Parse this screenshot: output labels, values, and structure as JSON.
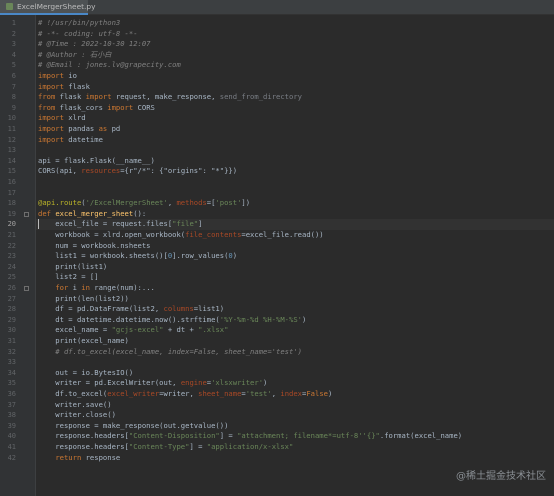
{
  "tab": {
    "file_name": "ExcelMergerSheet.py",
    "icon": "python-file-icon"
  },
  "current_line": 20,
  "lines": [
    [
      [
        "cm",
        "# !/usr/bin/python3"
      ]
    ],
    [
      [
        "cm",
        "# -*- coding: utf-8 -*-"
      ]
    ],
    [
      [
        "cm",
        "# @Time : 2022-10-30 12:07"
      ]
    ],
    [
      [
        "cm",
        "# @Author : 石小白"
      ]
    ],
    [
      [
        "cm",
        "# @Email : jones.lv@grapecity.com"
      ]
    ],
    [
      [
        "kw",
        "import"
      ],
      [
        "tx",
        " io"
      ]
    ],
    [
      [
        "kw",
        "import"
      ],
      [
        "tx",
        " flask"
      ]
    ],
    [
      [
        "kw",
        "from"
      ],
      [
        "tx",
        " flask "
      ],
      [
        "kw",
        "import"
      ],
      [
        "tx",
        " request, make_response, "
      ],
      [
        "dim",
        "send_from_directory"
      ]
    ],
    [
      [
        "kw",
        "from"
      ],
      [
        "tx",
        " flask_cors "
      ],
      [
        "kw",
        "import"
      ],
      [
        "tx",
        " CORS"
      ]
    ],
    [
      [
        "kw",
        "import"
      ],
      [
        "tx",
        " xlrd"
      ]
    ],
    [
      [
        "kw",
        "import"
      ],
      [
        "tx",
        " pandas "
      ],
      [
        "kw",
        "as"
      ],
      [
        "tx",
        " pd"
      ]
    ],
    [
      [
        "kw",
        "import"
      ],
      [
        "tx",
        " datetime"
      ]
    ],
    [],
    [
      [
        "tx",
        "api = flask.Flask(__name__)"
      ]
    ],
    [
      [
        "tx",
        "CORS(api, "
      ],
      [
        "pm",
        "resources"
      ],
      [
        "tx",
        "={r\"/*\": {\"origins\": \"*\"}})"
      ]
    ],
    [],
    [],
    [
      [
        "dc",
        "@api.route"
      ],
      [
        "tx",
        "("
      ],
      [
        "st",
        "'/ExcelMergerSheet'"
      ],
      [
        "tx",
        ", "
      ],
      [
        "pm",
        "methods"
      ],
      [
        "tx",
        "=["
      ],
      [
        "st",
        "'post'"
      ],
      [
        "tx",
        "])"
      ]
    ],
    [
      [
        "kw",
        "def "
      ],
      [
        "fn",
        "excel_merger_sheet"
      ],
      [
        "tx",
        "():"
      ]
    ],
    [
      [
        "tx",
        "    excel_file = request.files["
      ],
      [
        "st",
        "\"file\""
      ],
      [
        "tx",
        "]"
      ]
    ],
    [
      [
        "tx",
        "    workbook = xlrd.open_workbook("
      ],
      [
        "pm",
        "file_contents"
      ],
      [
        "tx",
        "=excel_file.read())"
      ]
    ],
    [
      [
        "tx",
        "    num = workbook.nsheets"
      ]
    ],
    [
      [
        "tx",
        "    list1 = workbook.sheets()["
      ],
      [
        "nm",
        "0"
      ],
      [
        "tx",
        "].row_values("
      ],
      [
        "nm",
        "0"
      ],
      [
        "tx",
        ")"
      ]
    ],
    [
      [
        "tx",
        "    print(list1)"
      ]
    ],
    [
      [
        "tx",
        "    list2 = []"
      ]
    ],
    [
      [
        "tx",
        "    "
      ],
      [
        "kw",
        "for"
      ],
      [
        "tx",
        " i "
      ],
      [
        "kw",
        "in"
      ],
      [
        "tx",
        " range(num):..."
      ]
    ],
    [
      [
        "tx",
        "    print(len(list2))"
      ]
    ],
    [
      [
        "tx",
        "    df = pd.DataFrame(list2, "
      ],
      [
        "pm",
        "columns"
      ],
      [
        "tx",
        "=list1)"
      ]
    ],
    [
      [
        "tx",
        "    dt = datetime.datetime.now().strftime("
      ],
      [
        "st",
        "'%Y-%m-%d %H-%M-%S'"
      ],
      [
        "tx",
        ")"
      ]
    ],
    [
      [
        "tx",
        "    excel_name = "
      ],
      [
        "st",
        "\"gcjs-excel\""
      ],
      [
        "tx",
        " + dt + "
      ],
      [
        "st",
        "\".xlsx\""
      ]
    ],
    [
      [
        "tx",
        "    print(excel_name)"
      ]
    ],
    [
      [
        "cm",
        "    # df.to_excel(excel_name, index=False, sheet_name='test')"
      ]
    ],
    [],
    [
      [
        "tx",
        "    out = io.BytesIO()"
      ]
    ],
    [
      [
        "tx",
        "    writer = pd.ExcelWriter(out, "
      ],
      [
        "pm",
        "engine"
      ],
      [
        "tx",
        "="
      ],
      [
        "st",
        "'xlsxwriter'"
      ],
      [
        "tx",
        ")"
      ]
    ],
    [
      [
        "tx",
        "    df.to_excel("
      ],
      [
        "pm",
        "excel_writer"
      ],
      [
        "tx",
        "=writer, "
      ],
      [
        "pm",
        "sheet_name"
      ],
      [
        "tx",
        "="
      ],
      [
        "st",
        "'test'"
      ],
      [
        "tx",
        ", "
      ],
      [
        "pm",
        "index"
      ],
      [
        "tx",
        "="
      ],
      [
        "kw",
        "False"
      ],
      [
        "tx",
        ")"
      ]
    ],
    [
      [
        "tx",
        "    writer.save()"
      ]
    ],
    [
      [
        "tx",
        "    writer.close()"
      ]
    ],
    [
      [
        "tx",
        "    response = make_response(out.getvalue())"
      ]
    ],
    [
      [
        "tx",
        "    response.headers["
      ],
      [
        "st",
        "\"Content-Disposition\""
      ],
      [
        "tx",
        "] = "
      ],
      [
        "st",
        "\"attachment; filename*=utf-8''{}\""
      ],
      [
        "tx",
        ".format(excel_name)"
      ]
    ],
    [
      [
        "tx",
        "    response.headers["
      ],
      [
        "st",
        "\"Content-Type\""
      ],
      [
        "tx",
        "] = "
      ],
      [
        "st",
        "\"application/x-xlsx\""
      ]
    ],
    [
      [
        "tx",
        "    "
      ],
      [
        "kw",
        "return"
      ],
      [
        "tx",
        " response"
      ]
    ]
  ],
  "watermark": "@稀土掘金技术社区"
}
